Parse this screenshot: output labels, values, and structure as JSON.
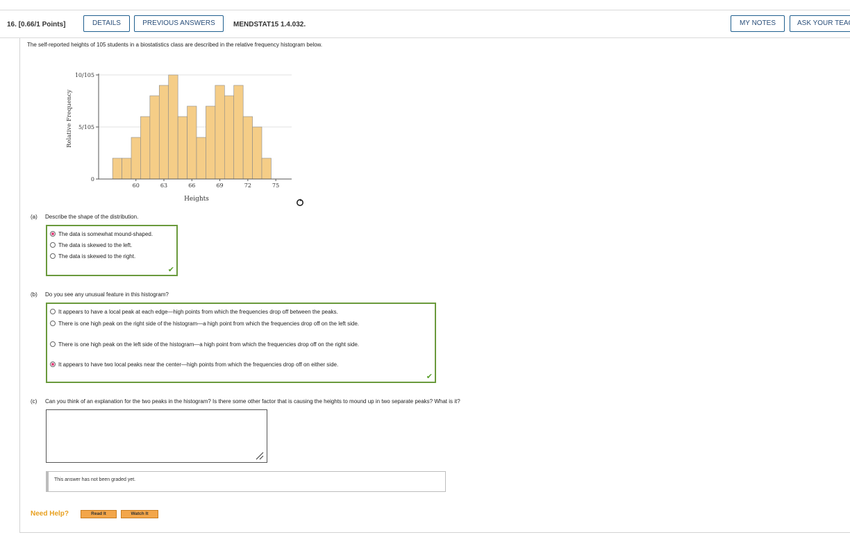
{
  "header": {
    "question_number": "16. [0.66/1 Points]",
    "details_label": "DETAILS",
    "previous_answers_label": "PREVIOUS ANSWERS",
    "question_code": "MENDSTAT15 1.4.032.",
    "my_notes_label": "MY NOTES",
    "ask_teacher_label": "ASK YOUR TEACHER"
  },
  "intro": "The self-reported heights of 105 students in a biostatistics class are described in the relative frequency histogram below.",
  "chart_data": {
    "type": "bar",
    "title": "",
    "xlabel": "Heights",
    "ylabel": "Relative Frequency",
    "y_ticks": [
      "0",
      "5/105",
      "10/105"
    ],
    "x_ticks": [
      "60",
      "63",
      "66",
      "69",
      "72",
      "75"
    ],
    "x_tick_values": [
      60,
      63,
      66,
      69,
      72,
      75
    ],
    "bin_width": 1,
    "bins": [
      58,
      59,
      60,
      61,
      62,
      63,
      64,
      65,
      66,
      67,
      68,
      69,
      70,
      71,
      72,
      73,
      74,
      75
    ],
    "values": [
      2,
      2,
      4,
      6,
      8,
      9,
      10,
      6,
      7,
      4,
      7,
      9,
      8,
      9,
      6,
      5,
      2,
      0
    ],
    "denominator": 105,
    "ylim": [
      0,
      10
    ],
    "grid": true,
    "bar_color": "#f5cd87"
  },
  "part_a": {
    "label": "(a)",
    "question": "Describe the shape of the distribution.",
    "options": [
      {
        "text": "The data is somewhat mound-shaped.",
        "selected": true
      },
      {
        "text": "The data is skewed to the left.",
        "selected": false
      },
      {
        "text": "The data is skewed to the right.",
        "selected": false
      }
    ]
  },
  "part_b": {
    "label": "(b)",
    "question": "Do you see any unusual feature in this histogram?",
    "options": [
      {
        "text": "It appears to have a local peak at each edge—high points from which the frequencies drop off between the peaks.",
        "selected": false
      },
      {
        "text": "There is one high peak on the right side of the histogram—a high point from which the frequencies drop off on the left side.",
        "selected": false
      },
      {
        "text": "There is one high peak on the left side of the histogram—a high point from which the frequencies drop off on the right side.",
        "selected": false
      },
      {
        "text": "It appears to have two local peaks near the center—high points from which the frequencies drop off on either side.",
        "selected": true
      }
    ]
  },
  "part_c": {
    "label": "(c)",
    "question": "Can you think of an explanation for the two peaks in the histogram? Is there some other factor that is causing the heights to mound up in two separate peaks? What is it?",
    "answer": "",
    "graded_message": "This answer has not been graded yet."
  },
  "help": {
    "label": "Need Help?",
    "read_it": "Read It",
    "watch_it": "Watch It"
  },
  "colors": {
    "accent": "#1f5f8f",
    "correct": "#6a9a3c",
    "selected_radio": "#e0407a",
    "help": "#e8a020"
  }
}
